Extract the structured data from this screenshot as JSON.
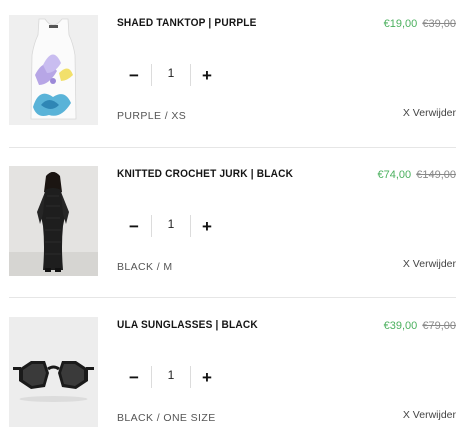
{
  "cart": {
    "items": [
      {
        "title": "SHAED TANKTOP | PURPLE",
        "price_sale": "€19,00",
        "price_original": "€39,00",
        "quantity": "1",
        "variant": "PURPLE / XS",
        "remove_label": "X Verwijder",
        "image_icon": "tanktop-image"
      },
      {
        "title": "KNITTED CROCHET JURK | BLACK",
        "price_sale": "€74,00",
        "price_original": "€149,00",
        "quantity": "1",
        "variant": "BLACK / M",
        "remove_label": "X Verwijder",
        "image_icon": "dress-image"
      },
      {
        "title": "ULA SUNGLASSES | BLACK",
        "price_sale": "€39,00",
        "price_original": "€79,00",
        "quantity": "1",
        "variant": "BLACK / ONE SIZE",
        "remove_label": "X Verwijder",
        "image_icon": "sunglasses-image"
      }
    ],
    "qty_minus_label": "−",
    "qty_plus_label": "+"
  },
  "colors": {
    "sale_price": "#4bb05e",
    "original_price": "#888888",
    "divider": "#e6e6e6"
  }
}
